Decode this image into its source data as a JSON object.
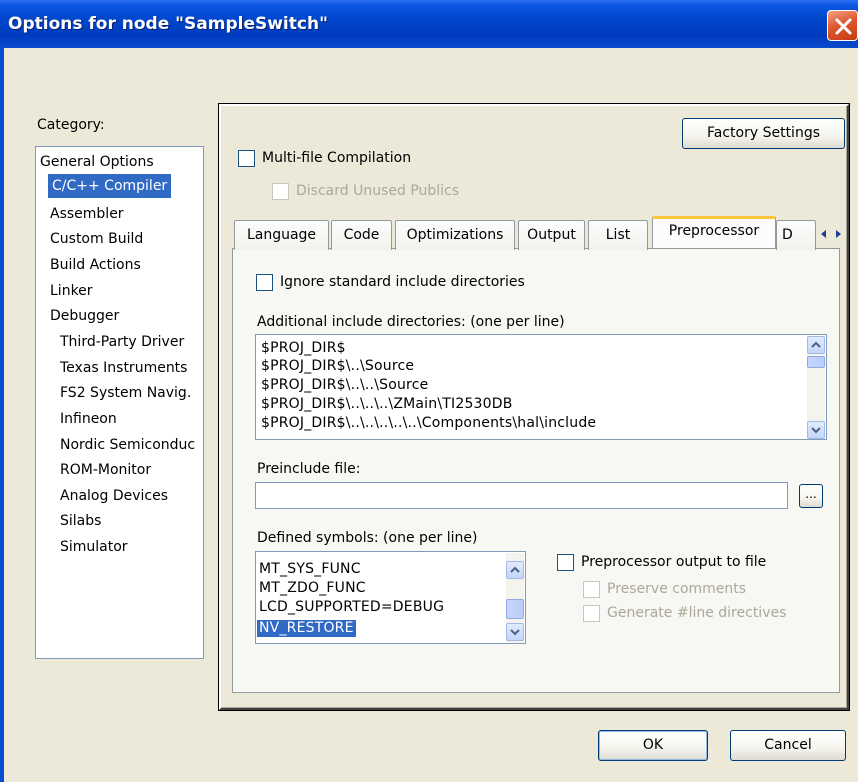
{
  "window": {
    "title": "Options for node \"SampleSwitch\""
  },
  "category": {
    "label": "Category:",
    "items": [
      {
        "label": "General Options"
      },
      {
        "label": "C/C++ Compiler"
      },
      {
        "label": "Assembler"
      },
      {
        "label": "Custom Build"
      },
      {
        "label": "Build Actions"
      },
      {
        "label": "Linker"
      },
      {
        "label": "Debugger"
      },
      {
        "label": "Third-Party Driver"
      },
      {
        "label": "Texas Instruments"
      },
      {
        "label": "FS2 System Navig."
      },
      {
        "label": "Infineon"
      },
      {
        "label": "Nordic Semiconduc"
      },
      {
        "label": "ROM-Monitor"
      },
      {
        "label": "Analog Devices"
      },
      {
        "label": "Silabs"
      },
      {
        "label": "Simulator"
      }
    ],
    "selected": "C/C++ Compiler"
  },
  "panel": {
    "factory_settings": "Factory Settings",
    "multifile_compilation": "Multi-file Compilation",
    "discard_unused_publics": "Discard Unused Publics",
    "tabs": [
      {
        "label": "Language"
      },
      {
        "label": "Code"
      },
      {
        "label": "Optimizations"
      },
      {
        "label": "Output"
      },
      {
        "label": "List"
      },
      {
        "label": "Preprocessor"
      },
      {
        "label": "D"
      }
    ],
    "active_tab": "Preprocessor"
  },
  "preprocessor": {
    "ignore_std_include": "Ignore standard include directories",
    "additional_include_label": "Additional include directories: (one per line)",
    "include_dirs": [
      "$PROJ_DIR$",
      "$PROJ_DIR$\\..\\Source",
      "$PROJ_DIR$\\..\\..\\Source",
      "$PROJ_DIR$\\..\\..\\..\\ZMain\\TI2530DB",
      "$PROJ_DIR$\\..\\..\\..\\..\\..\\Components\\hal\\include"
    ],
    "preinclude_label": "Preinclude file:",
    "preinclude_value": "",
    "browse_label": "...",
    "defined_symbols_label": "Defined symbols: (one per line)",
    "defined_symbols": [
      "MT_SYS_FUNC",
      "MT_ZDO_FUNC",
      "LCD_SUPPORTED=DEBUG",
      "NV_RESTORE"
    ],
    "selected_symbol": "NV_RESTORE",
    "preprocessor_output": "Preprocessor output to file",
    "preserve_comments": "Preserve comments",
    "generate_line_directives": "Generate #line directives"
  },
  "footer": {
    "ok": "OK",
    "cancel": "Cancel"
  },
  "colors": {
    "titlebar": "#0044c8",
    "selection": "#316ac5",
    "dialog_bg": "#ece9d8",
    "close": "#e0582e"
  }
}
